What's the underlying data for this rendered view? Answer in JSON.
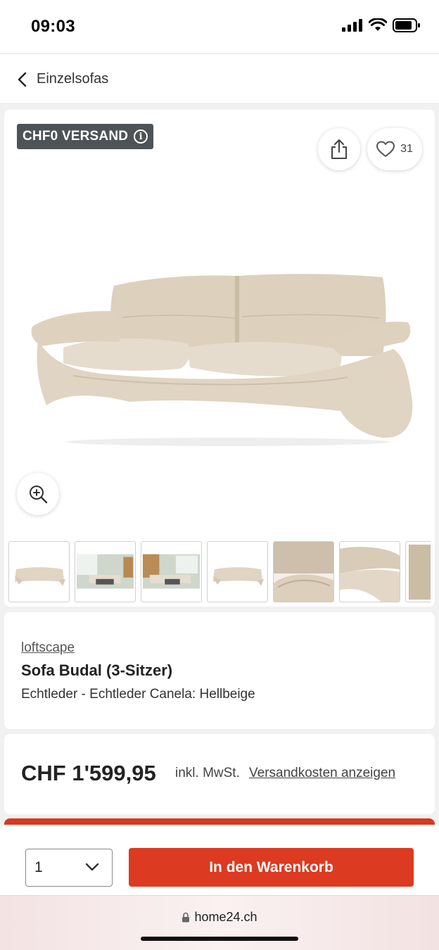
{
  "status_bar": {
    "time": "09:03"
  },
  "nav": {
    "back_label": "Einzelsofas"
  },
  "gallery": {
    "shipping_badge": "CHF0 VERSAND",
    "info_glyph": "i",
    "wishlist_count": "31",
    "thumbnail_count": 7
  },
  "product": {
    "brand": "loftscape",
    "title": "Sofa Budal (3-Sitzer)",
    "variant": "Echtleder - Echtleder Canela: Hellbeige"
  },
  "pricing": {
    "price": "CHF 1'599,95",
    "vat_note": "inkl. MwSt.",
    "shipping_link": "Versandkosten anzeigen"
  },
  "cart": {
    "quantity": "1",
    "add_to_cart_label": "In den Warenkorb"
  },
  "browser": {
    "url": "home24.ch"
  },
  "colors": {
    "accent": "#dc3a21",
    "badge": "#4d5356",
    "sofa": "#e3d7c5"
  }
}
